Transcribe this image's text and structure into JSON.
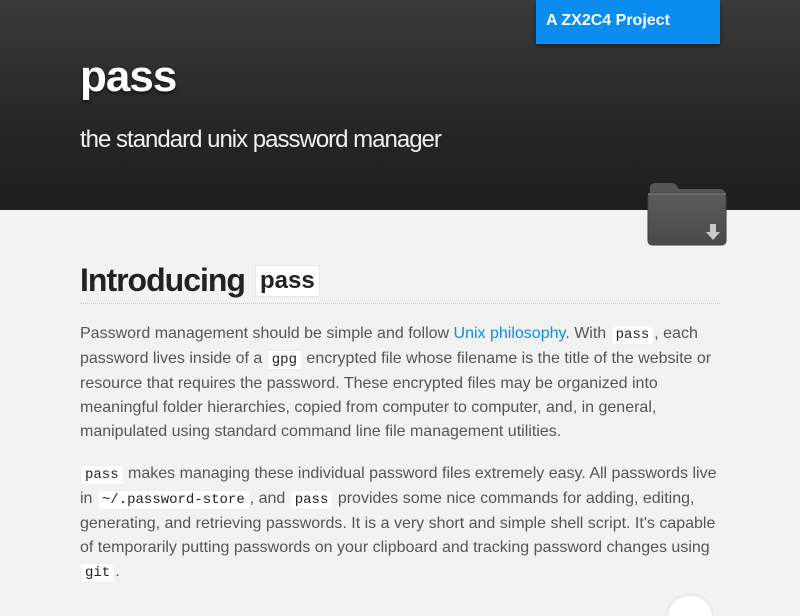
{
  "header": {
    "project_badge": "A ZX2C4 Project",
    "title": "pass",
    "tagline": "the standard unix password manager",
    "download_icon": "folder-download-icon"
  },
  "intro": {
    "heading_text": "Introducing",
    "heading_code": "pass",
    "p1": {
      "t1": "Password management should be simple and follow ",
      "link": "Unix philosophy",
      "t2": ". With ",
      "c1": "pass",
      "t3": ", each password lives inside of a ",
      "c2": "gpg",
      "t4": " encrypted file whose filename is the title of the website or resource that requires the password. These encrypted files may be organized into meaningful folder hierarchies, copied from computer to computer, and, in general, manipulated using standard command line file management utilities."
    },
    "p2": {
      "c1": "pass",
      "t1": " makes managing these individual password files extremely easy. All passwords live in ",
      "c2": "~/.password-store",
      "t2": ", and ",
      "c3": "pass",
      "t3": " provides some nice commands for adding, editing, generating, and retrieving passwords. It is a very short and simple shell script. It's capable of temporarily putting passwords on your clipboard and tracking password changes using ",
      "c4": "git",
      "t4": "."
    }
  },
  "colors": {
    "accent": "#0a8cf0",
    "header_dark": "#262626",
    "page_bg": "#f2f2f2"
  }
}
